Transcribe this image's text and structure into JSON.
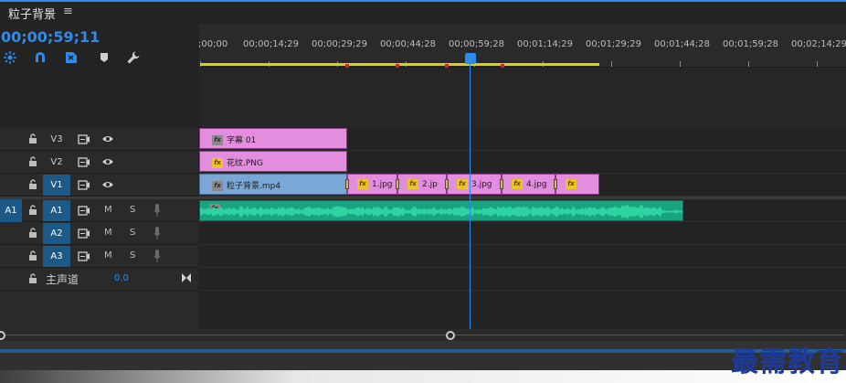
{
  "panel": {
    "title": "粒子背景",
    "menu_glyph": "≡"
  },
  "timecode": "00;00;59;11",
  "ruler": {
    "ticks": [
      ";00;00",
      "00;00;14;29",
      "00;00;29;29",
      "00;00;44;28",
      "00;00;59;28",
      "00;01;14;29",
      "00;01;29;29",
      "00;01;44;28",
      "00;01;59;28",
      "00;02;14;29"
    ]
  },
  "tools": [
    "snap-icon",
    "linked-selection-icon",
    "add-marker-icon",
    "marker-icon",
    "wrench-icon"
  ],
  "tracks": {
    "video": [
      {
        "target": "V3",
        "active": false
      },
      {
        "target": "V2",
        "active": false
      },
      {
        "target": "V1",
        "active": true
      }
    ],
    "audio": [
      {
        "source": "A1",
        "target": "A1",
        "m": "M",
        "s": "S"
      },
      {
        "source": "",
        "target": "A2",
        "m": "M",
        "s": "S"
      },
      {
        "source": "",
        "target": "A3",
        "m": "M",
        "s": "S"
      }
    ],
    "master": {
      "label": "主声道",
      "value": "0.0"
    }
  },
  "clips": {
    "v3": {
      "label": "字幕 01",
      "fx": "fx"
    },
    "v2": {
      "label": "花纹.PNG",
      "fx": "fx"
    },
    "v1_main": {
      "label": "粒子背景.mp4",
      "fx": "fx"
    },
    "v1_images": [
      {
        "label": "1.jpg",
        "fx": "fx"
      },
      {
        "label": "2.jp",
        "fx": "fx"
      },
      {
        "label": "3.jpg",
        "fx": "fx"
      },
      {
        "label": "4.jpg",
        "fx": "fx"
      },
      {
        "label": "",
        "fx": "fx"
      }
    ],
    "a1": {
      "fx": "fx"
    }
  },
  "watermark": "最需教育",
  "colors": {
    "accent": "#2d8ceb",
    "clip_pink": "#e28ddd",
    "clip_blue": "#7ba7d6",
    "clip_audio": "#1aa37f",
    "work_area": "#d6d212"
  }
}
